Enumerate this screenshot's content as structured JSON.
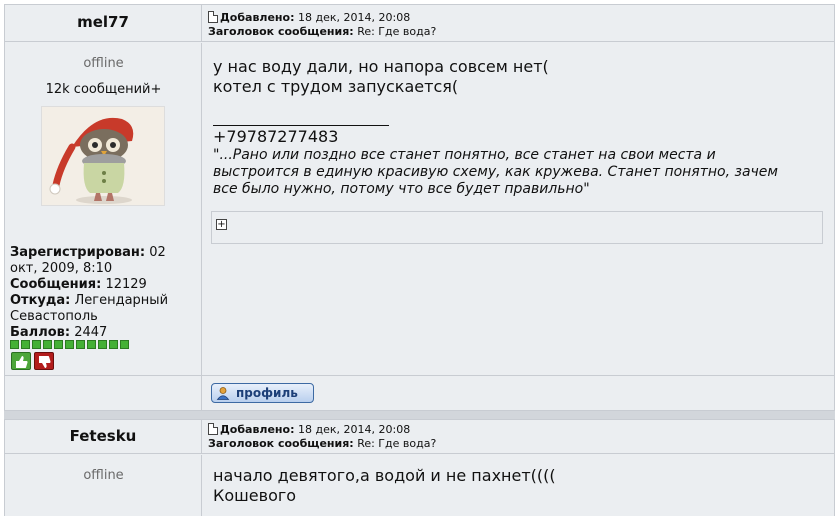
{
  "posts": [
    {
      "author": "mel77",
      "status": "offline",
      "rank": "12k сообщений+",
      "header": {
        "added_label": "Добавлено:",
        "added_value": "18 дек, 2014, 20:08",
        "subject_label": "Заголовок сообщения:",
        "subject_value": "Re: Где вода?"
      },
      "info": {
        "registered_label": "Зарегистрирован:",
        "registered_value": "02 окт, 2009, 8:10",
        "messages_label": "Сообщения:",
        "messages_value": "12129",
        "from_label": "Откуда:",
        "from_value": "Легендарный Севастополь",
        "points_label": "Баллов:",
        "points_value": "2447"
      },
      "message_lines": [
        "у нас воду дали, но напора совсем нет(",
        "котел с трудом запускается("
      ],
      "signature_phone": "+79787277483",
      "signature_quote": "\"...Рано или поздно все станет понятно, все станет на свои места и выстроится в единую красивую схему, как кружева. Станет понятно, зачем все было нужно, потому что все будет правильно\"",
      "profile_button": "профиль"
    },
    {
      "author": "Fetesku",
      "status": "offline",
      "header": {
        "added_label": "Добавлено:",
        "added_value": "18 дек, 2014, 20:08",
        "subject_label": "Заголовок сообщения:",
        "subject_value": "Re: Где вода?"
      },
      "message_lines": [
        "начало девятого,а водой и не пахнет((((",
        "Кошевого"
      ]
    }
  ],
  "colors": {
    "reputation_green": "#44b036",
    "vote_down_red": "#b21c1c",
    "panel_bg": "#ebeef1"
  },
  "icons": {
    "header": "document-icon",
    "spoiler": "plus-box-icon",
    "vote_up": "thumbs-up-icon",
    "vote_down": "thumbs-down-icon",
    "profile": "user-icon"
  }
}
